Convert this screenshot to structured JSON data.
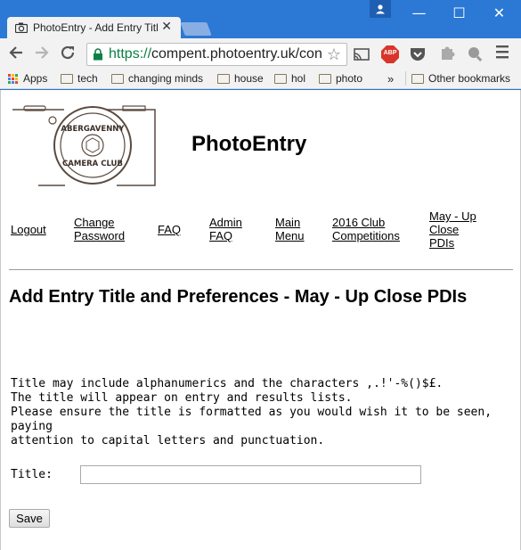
{
  "browser": {
    "tab": {
      "title": "PhotoEntry - Add Entry Title"
    },
    "window_controls": {
      "minimize": "—",
      "maximize": "☐",
      "close": "✕"
    },
    "url": {
      "scheme": "https://",
      "host": "compent.photoentry.uk/con"
    },
    "bookmarks": {
      "apps": "Apps",
      "items": [
        "tech",
        "changing minds",
        "house",
        "hol",
        "photo"
      ],
      "overflow": "»",
      "other": "Other bookmarks"
    },
    "extensions": {
      "adblock_label": "ABP"
    }
  },
  "page": {
    "logo": {
      "line1": "ABERGAVENNY",
      "line2": "CAMERA CLUB"
    },
    "site_title": "PhotoEntry",
    "nav": {
      "logout": "Logout",
      "change_password": [
        "Change",
        "Password"
      ],
      "faq": "FAQ",
      "admin_faq": [
        "Admin",
        "FAQ"
      ],
      "main_menu": [
        "Main",
        "Menu"
      ],
      "club_competitions": [
        "2016 Club",
        "Competitions"
      ],
      "may_up_close": [
        "May - Up",
        "Close",
        "PDIs"
      ]
    },
    "heading": "Add Entry Title and Preferences - May - Up Close PDIs",
    "instructions": [
      "Title may include alphanumerics and the characters ,.!'-%()$£.",
      "The title will appear on entry and results lists.",
      "Please ensure the title is formatted as you would wish it to be seen, paying",
      "attention to capital letters and punctuation."
    ],
    "form": {
      "title_label": "Title:",
      "title_value": "",
      "save_label": "Save"
    }
  }
}
